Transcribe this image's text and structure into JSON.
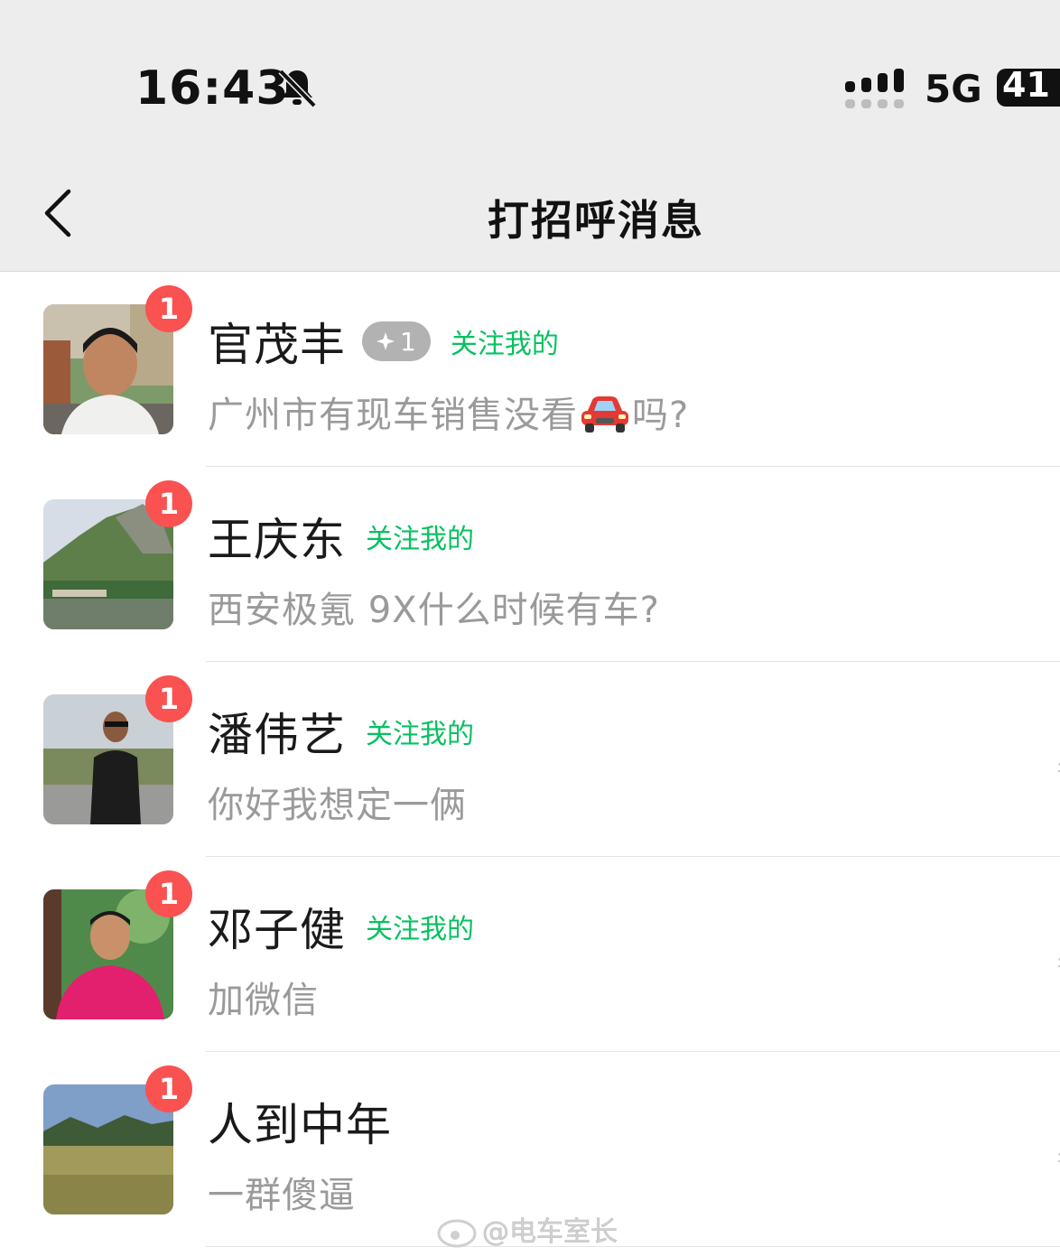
{
  "status_bar": {
    "time": "16:43",
    "network": "5G",
    "battery": "41",
    "icons": [
      "bell-slash-icon",
      "signal-icon"
    ]
  },
  "nav": {
    "title": "打招呼消息",
    "back_icon": "chevron-left-icon"
  },
  "colors": {
    "accent_green": "#07c160",
    "badge_red": "#fa5151"
  },
  "messages": [
    {
      "name": "官茂丰",
      "level": "1",
      "tag": "关注我的",
      "message_pre": "广州市有现车销售没看",
      "message_emoji": "car-emoji",
      "message_post": "吗?",
      "unread": "1",
      "time_stub": ""
    },
    {
      "name": "王庆东",
      "tag": "关注我的",
      "message": "西安极氪 9X什么时候有车?",
      "unread": "1",
      "time_stub": ""
    },
    {
      "name": "潘伟艺",
      "tag": "关注我的",
      "message": "你好我想定一俩",
      "unread": "1",
      "time_stub": "星"
    },
    {
      "name": "邓子健",
      "tag": "关注我的",
      "message": "加微信",
      "unread": "1",
      "time_stub": "星"
    },
    {
      "name": "人到中年",
      "message": "一群傻逼",
      "unread": "1",
      "time_stub": "星"
    }
  ],
  "watermark": {
    "text": "@电车室长"
  }
}
